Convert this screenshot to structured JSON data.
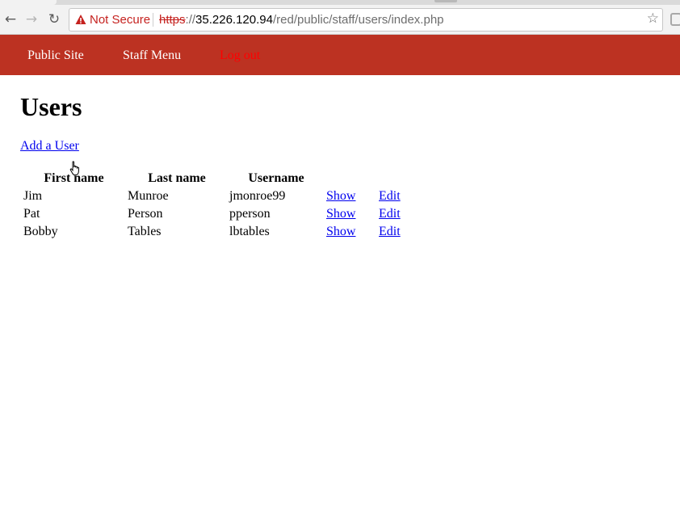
{
  "browser": {
    "security_label": "Not Secure",
    "url_scheme": "https",
    "url_sep": "://",
    "url_host": "35.226.120.94",
    "url_path": "/red/public/staff/users/index.php",
    "back_icon": "←",
    "forward_icon": "→",
    "reload_icon": "↻",
    "star_icon": "☆"
  },
  "site_nav": {
    "items": [
      {
        "label": "Public Site"
      },
      {
        "label": "Staff Menu"
      },
      {
        "label": "Log out"
      }
    ],
    "colors": {
      "bar": "#bc3222",
      "link": "#ffffff",
      "logout": "#ff0000"
    }
  },
  "page": {
    "title": "Users",
    "add_link": "Add a User"
  },
  "users_table": {
    "headers": [
      "First name",
      "Last name",
      "Username",
      "",
      ""
    ],
    "rows": [
      {
        "first": "Jim",
        "last": "Munroe",
        "username": "jmonroe99",
        "show": "Show",
        "edit": "Edit"
      },
      {
        "first": "Pat",
        "last": "Person",
        "username": "pperson",
        "show": "Show",
        "edit": "Edit"
      },
      {
        "first": "Bobby",
        "last": "Tables",
        "username": "lbtables",
        "show": "Show",
        "edit": "Edit"
      }
    ]
  }
}
